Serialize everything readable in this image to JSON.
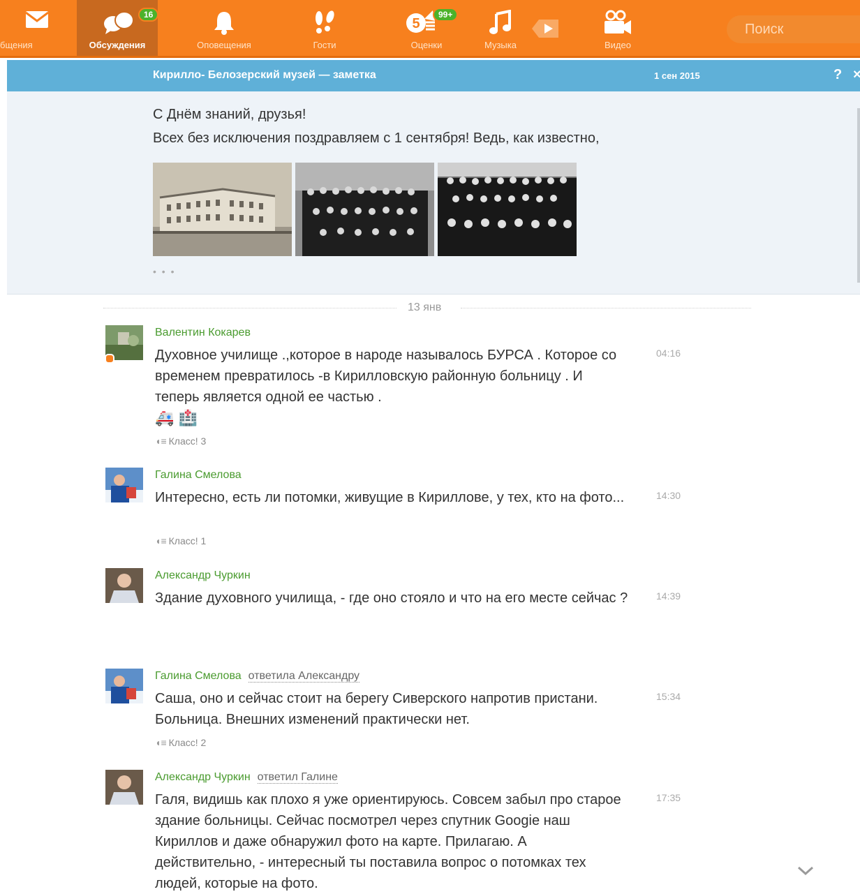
{
  "nav": {
    "items": [
      {
        "label": "бщения",
        "icon": "envelope-icon"
      },
      {
        "label": "Обсуждения",
        "icon": "discussions-icon",
        "badge": "16"
      },
      {
        "label": "Оповещения",
        "icon": "bell-icon"
      },
      {
        "label": "Гости",
        "icon": "footprints-icon"
      },
      {
        "label": "Оценки",
        "icon": "rating-icon",
        "badge": "99+"
      },
      {
        "label": "Музыка",
        "icon": "music-note-icon"
      },
      {
        "label": "Видео",
        "icon": "video-camera-icon"
      }
    ],
    "search_placeholder": "Поиск",
    "brand_color": "#f7801e"
  },
  "header": {
    "title": "Кирилло- Белозерский музей — заметка",
    "date": "1 сен 2015",
    "help": "?",
    "close": "×"
  },
  "note": {
    "line1": "С Днём знаний, друзья!",
    "line2": "Всех без исключения поздравляем с 1 сентября! Ведь, как известно,",
    "more": "• • •"
  },
  "separator": "13 янв",
  "comments": [
    {
      "author": "Валентин Кокарев",
      "text": "Духовное училище .,которое в народе называлось БУРСА . Которое со временем превратилось -в Кирилловскую районную больницу . И теперь является одной ее частью .",
      "emoji": "🚑 🏥",
      "time": "04:16",
      "klass": "Класс! 3"
    },
    {
      "author": "Галина Смелова",
      "text": "Интересно, есть ли потомки, живущие в Кириллове, у тех, кто на фото...",
      "time": "14:30",
      "klass": "Класс! 1"
    },
    {
      "author": "Александр Чуркин",
      "text": "Здание духовного училища, - где оно стояло и что на его месте сейчас ?",
      "time": "14:39"
    },
    {
      "author": "Галина Смелова",
      "reply": "ответила Александру",
      "text": "Саша, оно и сейчас стоит на берегу Сиверского напротив пристани. Больница. Внешних изменений практически нет.",
      "time": "15:34",
      "klass": "Класс! 2"
    },
    {
      "author": "Александр Чуркин",
      "reply": "ответил Галине",
      "text": "Галя, видишь как плохо я уже ориентируюсь. Совсем забыл про старое здание больницы. Сейчас посмотрел через спутник Googie наш Кириллов и даже обнаружил фото на карте. Прилагаю. А действительно, - интересный ты поставила вопрос о потомках тех людей, которые на фото.",
      "time": "17:35"
    }
  ]
}
